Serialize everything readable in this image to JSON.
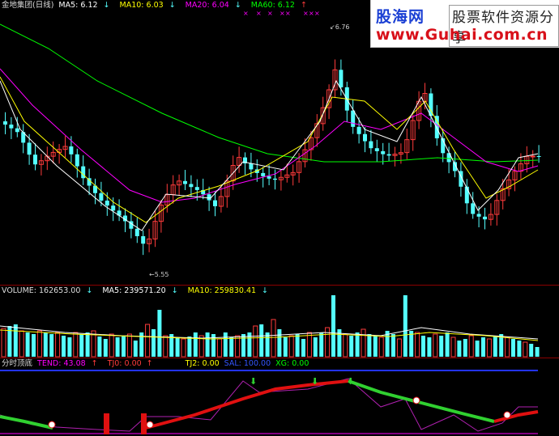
{
  "price_legend": {
    "title": "金地集团(日线)",
    "ma5_label": "MA5: 6.12",
    "ma10_label": "MA10: 6.03",
    "ma20_label": "MA20: 6.04",
    "ma60_label": "MA60: 6.12"
  },
  "price_annotations": {
    "high": "6.76",
    "low": "5.55"
  },
  "volume_legend": {
    "volume_label": "VOLUME: 162653.00",
    "ma5_label": "MA5: 239571.20",
    "ma10_label": "MA10: 259830.41"
  },
  "indicator_legend": {
    "title": "分时顶底",
    "tend_label": "TEND: 43.08",
    "tj0_label": "TJ0: 0.00",
    "tj2_label": "TJ2: 0.00",
    "sal_label": "SAL: 100.00",
    "xg_label": "XG: 0.00"
  },
  "watermark": {
    "site_cn": "股海网",
    "slogan": "股票软件资源分享",
    "url": "www.Guhai.com.cn"
  },
  "colors": {
    "up": "#ff3b3b",
    "down": "#54ffff",
    "ma5": "#ffffff",
    "ma10": "#ffff00",
    "ma20": "#ff00ff",
    "ma60": "#00ff00",
    "watermark_blue": "#1a3fd4",
    "watermark_red": "#d8101a"
  },
  "chart_data": {
    "type": "candlestick",
    "price_extremes": {
      "high": 6.76,
      "low": 5.55
    },
    "ma_latest": {
      "MA5": 6.12,
      "MA10": 6.03,
      "MA20": 6.04,
      "MA60": 6.12
    },
    "volume_latest": 162653.0,
    "volume_ma_latest": {
      "MA5": 239571.2,
      "MA10": 259830.41
    },
    "indicator_latest": {
      "TEND": 43.08,
      "TJ0": 0.0,
      "TJ2": 0.0,
      "SAL": 100.0,
      "XG": 0.0
    }
  }
}
